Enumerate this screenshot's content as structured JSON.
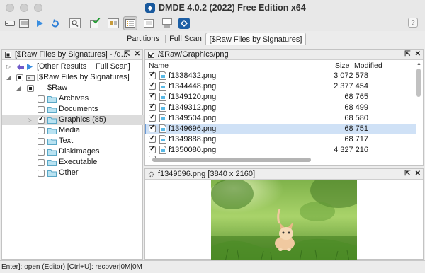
{
  "window": {
    "title": "DMDE 4.0.2 (2022) Free Edition x64"
  },
  "toolbar": {
    "buttons": [
      "drive-icon",
      "list-icon",
      "play-icon",
      "refresh-icon",
      "search-icon",
      "check-icon",
      "settings-icon",
      "list-view-icon",
      "detail-view-icon",
      "thumb-view-icon",
      "app-logo-icon"
    ],
    "help_label": "?"
  },
  "tabs": [
    {
      "label": "Partitions"
    },
    {
      "label": "Full Scan"
    },
    {
      "label": "[$Raw Files by Signatures]"
    }
  ],
  "left_panel": {
    "header": "[$Raw Files by Signatures] - /d...",
    "tree": [
      {
        "label": "[Other Results + Full Scan]"
      },
      {
        "label": "[$Raw Files by Signatures]"
      },
      {
        "label": "$Raw"
      },
      {
        "label": "Archives"
      },
      {
        "label": "Documents"
      },
      {
        "label": "Graphics (85)"
      },
      {
        "label": "Media"
      },
      {
        "label": "Text"
      },
      {
        "label": "DiskImages"
      },
      {
        "label": "Executable"
      },
      {
        "label": "Other"
      }
    ]
  },
  "file_panel": {
    "header": "/$Raw/Graphics/png",
    "columns": {
      "name": "Name",
      "size": "Size",
      "modified": "Modified"
    },
    "rows": [
      {
        "name": "f1338432.png",
        "size": "3 072 578"
      },
      {
        "name": "f1344448.png",
        "size": "2 377 454"
      },
      {
        "name": "f1349120.png",
        "size": "68 765"
      },
      {
        "name": "f1349312.png",
        "size": "68 499"
      },
      {
        "name": "f1349504.png",
        "size": "68 580"
      },
      {
        "name": "f1349696.png",
        "size": "68 751"
      },
      {
        "name": "f1349888.png",
        "size": "68 717"
      },
      {
        "name": "f1350080.png",
        "size": "4 327 216"
      }
    ],
    "selected_row": 5
  },
  "preview_panel": {
    "header": "f1349696.png [3840 x 2160]"
  },
  "status": {
    "text": "Enter]: open (Editor)  [Ctrl+U]: recover|0M|0M"
  }
}
